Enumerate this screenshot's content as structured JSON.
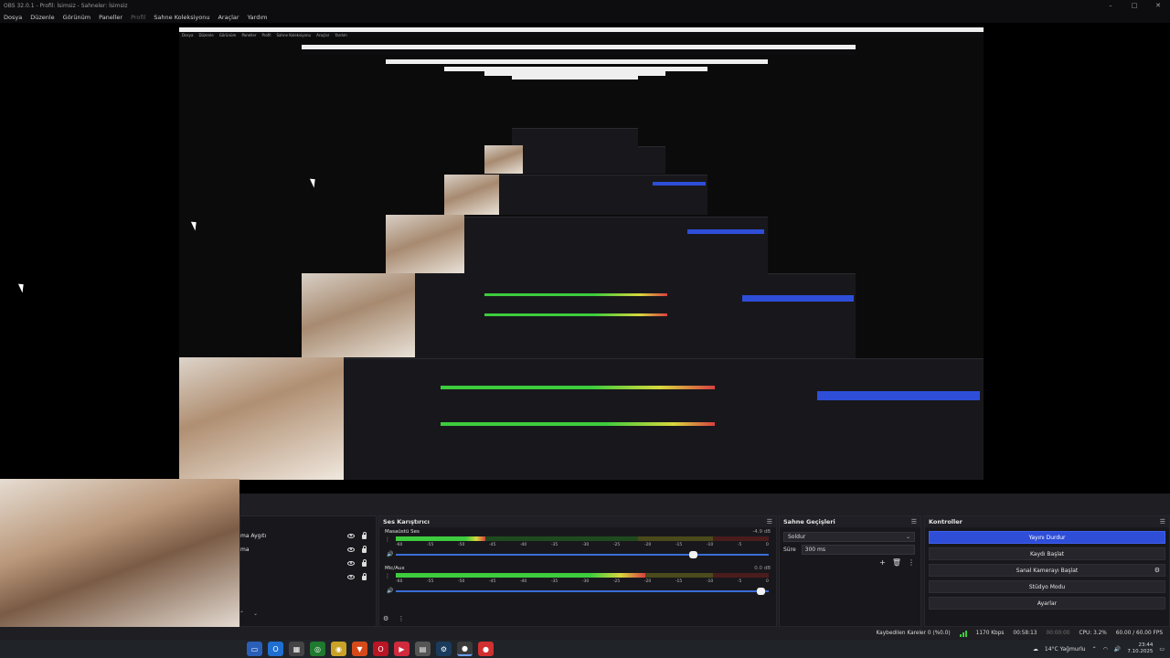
{
  "window": {
    "title": "OBS 32.0.1 - Profil: İsimsiz - Sahneler: İsimsiz"
  },
  "menu": [
    "Dosya",
    "Düzenle",
    "Görünüm",
    "Paneller",
    "Profil",
    "Sahne Koleksiyonu",
    "Araçlar",
    "Yardım"
  ],
  "sources": {
    "items": [
      "ma Aygıtı",
      "ma"
    ]
  },
  "mixer": {
    "title": "Ses Karıştırıcı",
    "tracks": [
      {
        "name": "Masaüstü Ses",
        "db": "-4.9 dB",
        "level_pct": 0.24,
        "fader_pct": 0.8
      },
      {
        "name": "Mic/Aux",
        "db": "0.0 dB",
        "level_pct": 0.67,
        "fader_pct": 0.98
      }
    ],
    "scale": [
      "-60",
      "-55",
      "-50",
      "-45",
      "-40",
      "-35",
      "-30",
      "-25",
      "-20",
      "-15",
      "-10",
      "-5",
      "0"
    ]
  },
  "transitions": {
    "title": "Sahne Geçişleri",
    "selected": "Soldur",
    "duration_label": "Süre",
    "duration_value": "300 ms"
  },
  "controls": {
    "title": "Kontroller",
    "buttons": [
      "Yayını Durdur",
      "Kaydı Başlat",
      "Sanal Kamerayı Başlat",
      "Stüdyo Modu",
      "Ayarlar"
    ]
  },
  "status": {
    "dropped": "Kaybedilen Kareler 0 (%0.0)",
    "bitrate": "1170 Kbps",
    "stream_time": "00:58:13",
    "rec_time": "00:00:00",
    "cpu": "CPU: 3.2%",
    "fps": "60.00 / 60.00 FPS"
  },
  "taskbar": {
    "weather": "14°C Yağmurlu",
    "time": "23:44",
    "date": "7.10.2025"
  },
  "colors": {
    "accent": "#2e4ed8",
    "meter_green": "#3dcc3d",
    "meter_yellow": "#d8d83d",
    "meter_red": "#d84040"
  }
}
